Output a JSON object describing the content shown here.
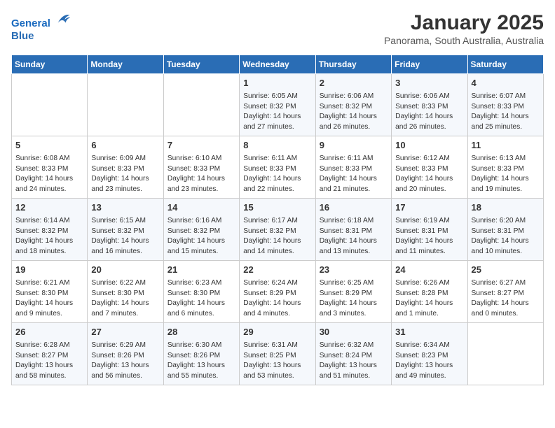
{
  "header": {
    "logo_line1": "General",
    "logo_line2": "Blue",
    "title": "January 2025",
    "subtitle": "Panorama, South Australia, Australia"
  },
  "weekdays": [
    "Sunday",
    "Monday",
    "Tuesday",
    "Wednesday",
    "Thursday",
    "Friday",
    "Saturday"
  ],
  "weeks": [
    [
      {
        "day": "",
        "info": ""
      },
      {
        "day": "",
        "info": ""
      },
      {
        "day": "",
        "info": ""
      },
      {
        "day": "1",
        "info": "Sunrise: 6:05 AM\nSunset: 8:32 PM\nDaylight: 14 hours\nand 27 minutes."
      },
      {
        "day": "2",
        "info": "Sunrise: 6:06 AM\nSunset: 8:32 PM\nDaylight: 14 hours\nand 26 minutes."
      },
      {
        "day": "3",
        "info": "Sunrise: 6:06 AM\nSunset: 8:33 PM\nDaylight: 14 hours\nand 26 minutes."
      },
      {
        "day": "4",
        "info": "Sunrise: 6:07 AM\nSunset: 8:33 PM\nDaylight: 14 hours\nand 25 minutes."
      }
    ],
    [
      {
        "day": "5",
        "info": "Sunrise: 6:08 AM\nSunset: 8:33 PM\nDaylight: 14 hours\nand 24 minutes."
      },
      {
        "day": "6",
        "info": "Sunrise: 6:09 AM\nSunset: 8:33 PM\nDaylight: 14 hours\nand 23 minutes."
      },
      {
        "day": "7",
        "info": "Sunrise: 6:10 AM\nSunset: 8:33 PM\nDaylight: 14 hours\nand 23 minutes."
      },
      {
        "day": "8",
        "info": "Sunrise: 6:11 AM\nSunset: 8:33 PM\nDaylight: 14 hours\nand 22 minutes."
      },
      {
        "day": "9",
        "info": "Sunrise: 6:11 AM\nSunset: 8:33 PM\nDaylight: 14 hours\nand 21 minutes."
      },
      {
        "day": "10",
        "info": "Sunrise: 6:12 AM\nSunset: 8:33 PM\nDaylight: 14 hours\nand 20 minutes."
      },
      {
        "day": "11",
        "info": "Sunrise: 6:13 AM\nSunset: 8:33 PM\nDaylight: 14 hours\nand 19 minutes."
      }
    ],
    [
      {
        "day": "12",
        "info": "Sunrise: 6:14 AM\nSunset: 8:32 PM\nDaylight: 14 hours\nand 18 minutes."
      },
      {
        "day": "13",
        "info": "Sunrise: 6:15 AM\nSunset: 8:32 PM\nDaylight: 14 hours\nand 16 minutes."
      },
      {
        "day": "14",
        "info": "Sunrise: 6:16 AM\nSunset: 8:32 PM\nDaylight: 14 hours\nand 15 minutes."
      },
      {
        "day": "15",
        "info": "Sunrise: 6:17 AM\nSunset: 8:32 PM\nDaylight: 14 hours\nand 14 minutes."
      },
      {
        "day": "16",
        "info": "Sunrise: 6:18 AM\nSunset: 8:31 PM\nDaylight: 14 hours\nand 13 minutes."
      },
      {
        "day": "17",
        "info": "Sunrise: 6:19 AM\nSunset: 8:31 PM\nDaylight: 14 hours\nand 11 minutes."
      },
      {
        "day": "18",
        "info": "Sunrise: 6:20 AM\nSunset: 8:31 PM\nDaylight: 14 hours\nand 10 minutes."
      }
    ],
    [
      {
        "day": "19",
        "info": "Sunrise: 6:21 AM\nSunset: 8:30 PM\nDaylight: 14 hours\nand 9 minutes."
      },
      {
        "day": "20",
        "info": "Sunrise: 6:22 AM\nSunset: 8:30 PM\nDaylight: 14 hours\nand 7 minutes."
      },
      {
        "day": "21",
        "info": "Sunrise: 6:23 AM\nSunset: 8:30 PM\nDaylight: 14 hours\nand 6 minutes."
      },
      {
        "day": "22",
        "info": "Sunrise: 6:24 AM\nSunset: 8:29 PM\nDaylight: 14 hours\nand 4 minutes."
      },
      {
        "day": "23",
        "info": "Sunrise: 6:25 AM\nSunset: 8:29 PM\nDaylight: 14 hours\nand 3 minutes."
      },
      {
        "day": "24",
        "info": "Sunrise: 6:26 AM\nSunset: 8:28 PM\nDaylight: 14 hours\nand 1 minute."
      },
      {
        "day": "25",
        "info": "Sunrise: 6:27 AM\nSunset: 8:27 PM\nDaylight: 14 hours\nand 0 minutes."
      }
    ],
    [
      {
        "day": "26",
        "info": "Sunrise: 6:28 AM\nSunset: 8:27 PM\nDaylight: 13 hours\nand 58 minutes."
      },
      {
        "day": "27",
        "info": "Sunrise: 6:29 AM\nSunset: 8:26 PM\nDaylight: 13 hours\nand 56 minutes."
      },
      {
        "day": "28",
        "info": "Sunrise: 6:30 AM\nSunset: 8:26 PM\nDaylight: 13 hours\nand 55 minutes."
      },
      {
        "day": "29",
        "info": "Sunrise: 6:31 AM\nSunset: 8:25 PM\nDaylight: 13 hours\nand 53 minutes."
      },
      {
        "day": "30",
        "info": "Sunrise: 6:32 AM\nSunset: 8:24 PM\nDaylight: 13 hours\nand 51 minutes."
      },
      {
        "day": "31",
        "info": "Sunrise: 6:34 AM\nSunset: 8:23 PM\nDaylight: 13 hours\nand 49 minutes."
      },
      {
        "day": "",
        "info": ""
      }
    ]
  ]
}
